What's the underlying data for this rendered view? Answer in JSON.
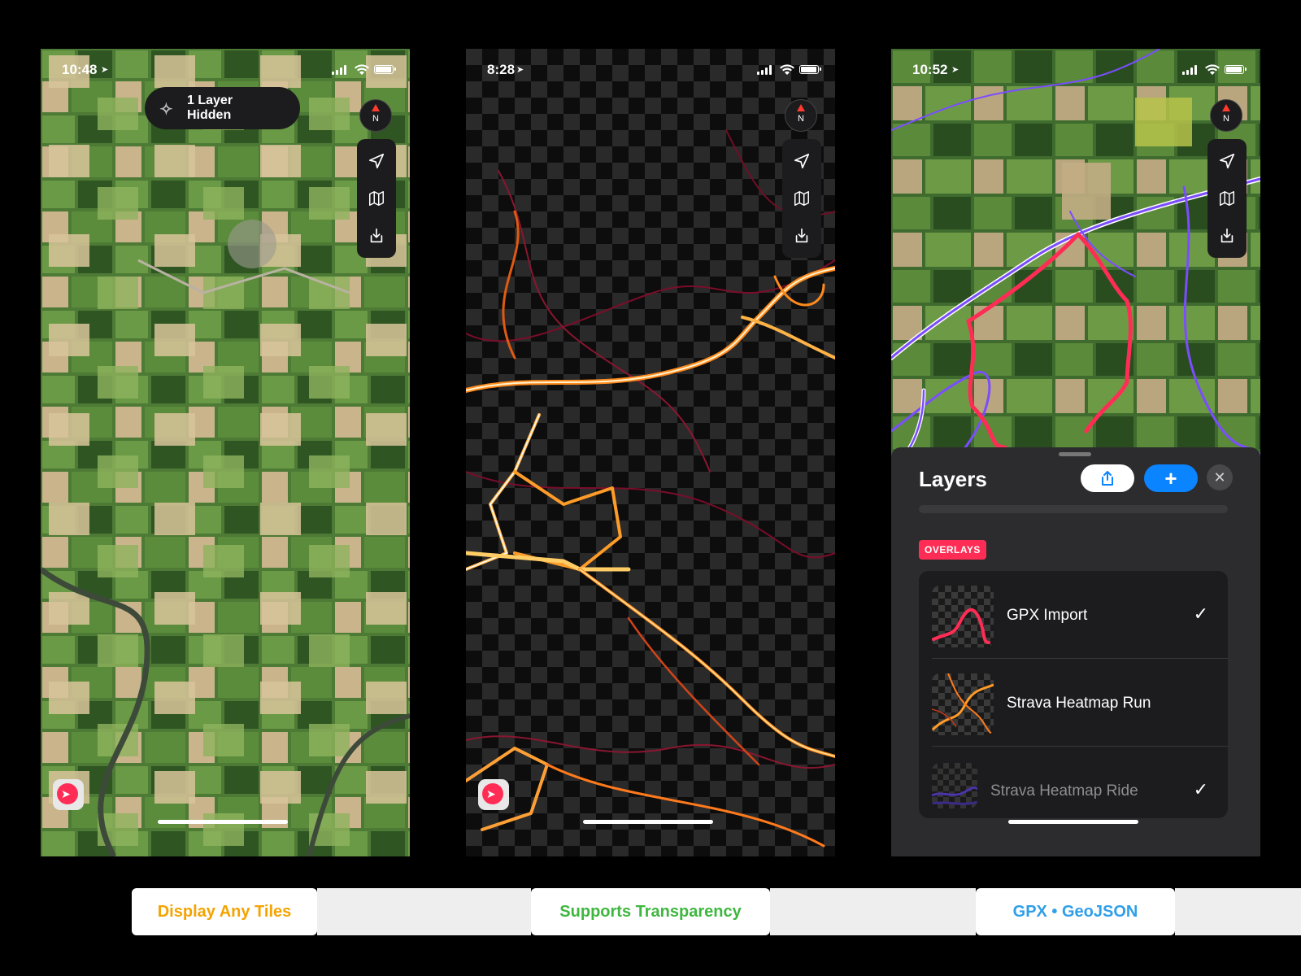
{
  "screens": [
    {
      "status_time": "10:48",
      "notice": "1 Layer Hidden",
      "map_style": "satellite"
    },
    {
      "status_time": "8:28",
      "map_style": "heatmap"
    },
    {
      "status_time": "10:52",
      "map_style": "satellite-with-overlays",
      "sheet": {
        "title": "Layers",
        "add_label": "+",
        "close_label": "✕",
        "section_label": "OVERLAYS",
        "layers": [
          {
            "name": "GPX Import",
            "checked": true,
            "check_glyph": "✓"
          },
          {
            "name": "Strava Heatmap Run",
            "checked": false,
            "check_glyph": ""
          },
          {
            "name": "Strava Heatmap Ride",
            "checked": true,
            "check_glyph": "✓"
          }
        ]
      }
    }
  ],
  "compass_label": "N",
  "icons": [
    "location-arrow-icon",
    "map-icon",
    "download-icon",
    "compass-icon",
    "sparkle-icon",
    "share-icon",
    "wifi-icon",
    "battery-icon",
    "signal-icon"
  ],
  "captions": [
    {
      "text": "Display Any Tiles",
      "color": "#f5a300"
    },
    {
      "text": "Supports Transparency",
      "color": "#3fb73f"
    },
    {
      "text": "GPX • GeoJSON",
      "color": "#2f9fe8"
    }
  ],
  "colors": {
    "accent_blue": "#0a84ff",
    "overlay_pink": "#ff2d55",
    "route_purple": "#7b4dff"
  }
}
